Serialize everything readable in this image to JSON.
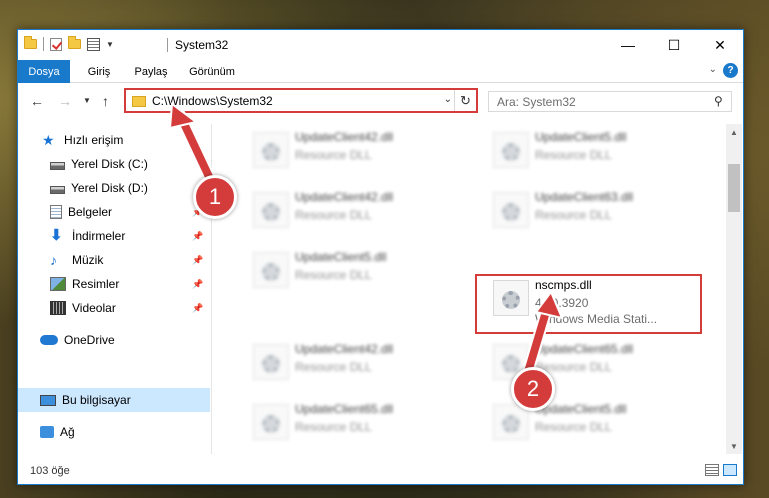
{
  "window": {
    "title": "System32",
    "controls": {
      "minimize": "—",
      "maximize": "☐",
      "close": "✕"
    }
  },
  "ribbon": {
    "tabs": [
      "Dosya",
      "Giriş",
      "Paylaş",
      "Görünüm"
    ],
    "help": "?"
  },
  "nav": {
    "back": "←",
    "forward": "→",
    "up": "↑",
    "address": "C:\\Windows\\System32",
    "search_placeholder": "Ara: System32"
  },
  "sidebar": {
    "items": [
      {
        "label": "Hızlı erişim",
        "icon": "star-icon"
      },
      {
        "label": "Yerel Disk (C:)",
        "icon": "disk-icon"
      },
      {
        "label": "Yerel Disk (D:)",
        "icon": "disk-icon"
      },
      {
        "label": "Belgeler",
        "icon": "documents-icon",
        "pinned": true
      },
      {
        "label": "İndirmeler",
        "icon": "download-icon",
        "pinned": true
      },
      {
        "label": "Müzik",
        "icon": "music-icon",
        "pinned": true
      },
      {
        "label": "Resimler",
        "icon": "pictures-icon",
        "pinned": true
      },
      {
        "label": "Videolar",
        "icon": "videos-icon",
        "pinned": true
      },
      {
        "label": "OneDrive",
        "icon": "onedrive-icon"
      },
      {
        "label": "Bu bilgisayar",
        "icon": "computer-icon",
        "selected": true
      },
      {
        "label": "Ağ",
        "icon": "network-icon"
      }
    ]
  },
  "files": [
    {
      "name": "UpdateClient42.dll",
      "desc": "Resource DLL"
    },
    {
      "name": "UpdateClient5.dll",
      "desc": "Resource DLL"
    },
    {
      "name": "UpdateClient42.dll",
      "desc": "Resource DLL"
    },
    {
      "name": "UpdateClient63.dll",
      "desc": "Resource DLL"
    },
    {
      "name": "UpdateClient5.dll",
      "desc": "Resource DLL"
    },
    {
      "name": "nscmps.dll",
      "version": "4.10.3920",
      "desc": "Windows Media Stati..."
    },
    {
      "name": "UpdateClient42.dll",
      "desc": "Resource DLL"
    },
    {
      "name": "UpdateClient65.dll",
      "desc": "Resource DLL"
    },
    {
      "name": "UpdateClient65.dll",
      "desc": "Resource DLL"
    },
    {
      "name": "UpdateClient5.dll",
      "desc": "Resource DLL"
    }
  ],
  "status": {
    "item_count": "103 öğe"
  },
  "annotations": {
    "badge1": "1",
    "badge2": "2",
    "color": "#d43c3c"
  }
}
